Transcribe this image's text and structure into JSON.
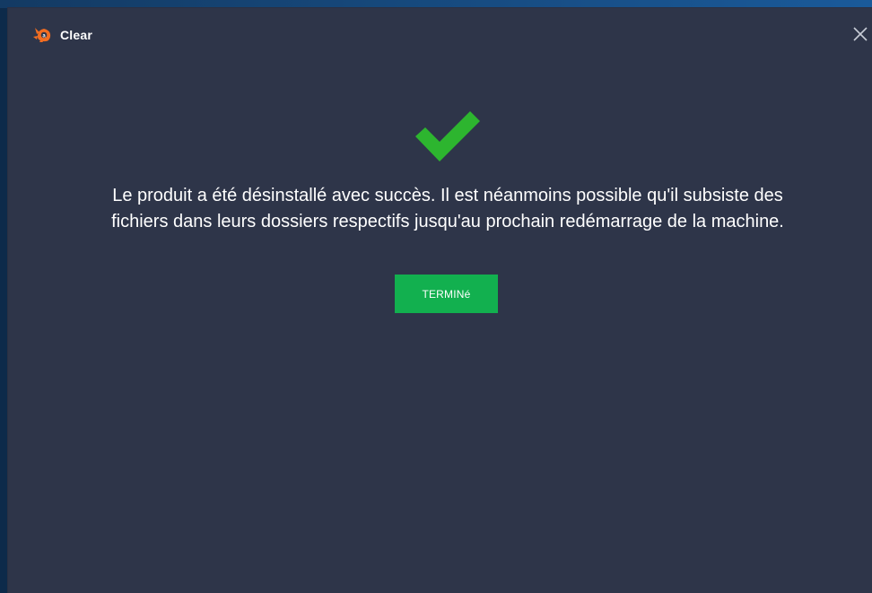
{
  "window": {
    "title": "Clear",
    "logo_icon": "avast-logo-icon",
    "close_icon": "close-icon"
  },
  "main": {
    "status_icon": "checkmark-icon",
    "message": "Le produit a été désinstallé avec succès. Il est néanmoins possible qu'il subsiste des fichiers dans leurs dossiers respectifs jusqu'au prochain redémarrage de la machine.",
    "done_label": "TERMINé"
  },
  "colors": {
    "window_bg": "#2e3549",
    "accent_green": "#12b04f",
    "check_green": "#2db52f",
    "logo_orange": "#f26d21"
  }
}
